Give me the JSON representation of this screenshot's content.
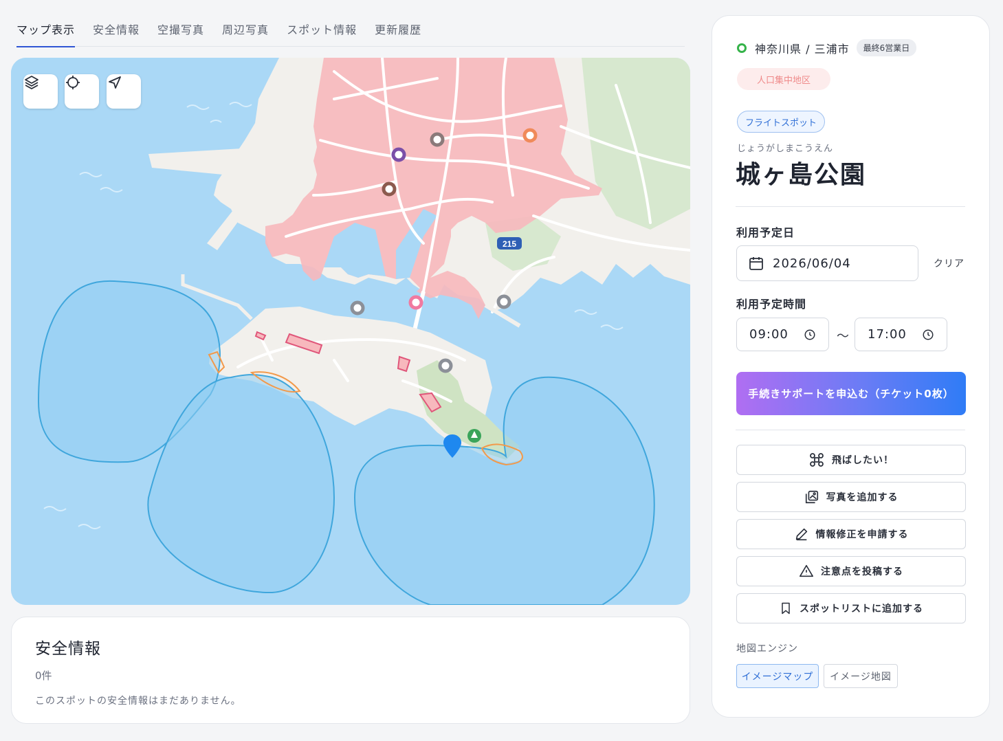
{
  "tabs": [
    {
      "label": "マップ表示",
      "active": true
    },
    {
      "label": "安全情報"
    },
    {
      "label": "空撮写真"
    },
    {
      "label": "周辺写真"
    },
    {
      "label": "スポット情報"
    },
    {
      "label": "更新履歴"
    }
  ],
  "map": {
    "route_label": "215",
    "controls": [
      "layers-icon",
      "crosshair-icon",
      "navigate-icon"
    ]
  },
  "safety": {
    "title": "安全情報",
    "count": "0件",
    "empty_message": "このスポットの安全情報はまだありません。"
  },
  "spot": {
    "location": "神奈川県 / 三浦市",
    "deadline_badge": "最終6営業日",
    "did_badge": "人口集中地区",
    "category_badge": "フライトスポット",
    "furigana": "じょうがしまこうえん",
    "name": "城ヶ島公園"
  },
  "schedule": {
    "date_label": "利用予定日",
    "date_value": "2026/06/04",
    "clear_label": "クリア",
    "time_label": "利用予定時間",
    "start_time": "09:00",
    "separator": "〜",
    "end_time": "17:00"
  },
  "cta_label": "手続きサポートを申込む（チケット0枚）",
  "actions": [
    {
      "label": "飛ばしたい！",
      "icon": "drone-icon"
    },
    {
      "label": "写真を追加する",
      "icon": "photo-add-icon"
    },
    {
      "label": "情報修正を申請する",
      "icon": "pencil-icon"
    },
    {
      "label": "注意点を投稿する",
      "icon": "warning-icon"
    },
    {
      "label": "スポットリストに追加する",
      "icon": "bookmark-icon"
    }
  ],
  "engine": {
    "label": "地図エンジン",
    "options": [
      "イメージマップ",
      "イメージ地図"
    ],
    "selected": "イメージマップ"
  },
  "colors": {
    "accent": "#2f55d4",
    "water": "#aad8f6",
    "land": "#f2f0ec",
    "populated_area": "#f7b8bd",
    "restricted_zone": "#8fcdf2",
    "marker_blue": "#1e88ef",
    "status_green": "#36b34a"
  }
}
